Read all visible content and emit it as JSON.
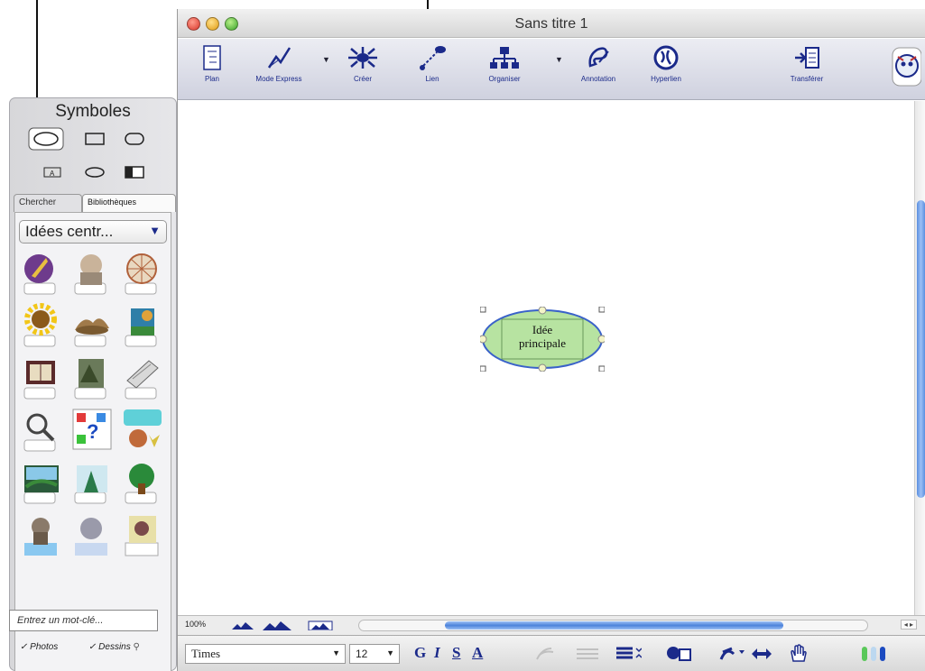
{
  "window": {
    "title": "Sans titre 1"
  },
  "toolbar": {
    "items": [
      {
        "label": "Plan",
        "icon": "outline-icon"
      },
      {
        "label": "Mode Express",
        "icon": "express-mode-icon"
      },
      {
        "label": "Créer",
        "icon": "create-icon"
      },
      {
        "label": "Lien",
        "icon": "link-icon"
      },
      {
        "label": "Organiser",
        "icon": "organize-icon"
      },
      {
        "label": "Annotation",
        "icon": "annotation-icon"
      },
      {
        "label": "Hyperlien",
        "icon": "hyperlink-icon"
      },
      {
        "label": "Transférer",
        "icon": "transfer-icon"
      }
    ]
  },
  "palette": {
    "title": "Symboles",
    "tabs": [
      "Chercher",
      "Bibliothèques"
    ],
    "library_selected": "Idées centr...",
    "search_placeholder": "Entrez un mot-clé...",
    "checkboxes": [
      {
        "label": "Photos",
        "checked": true
      },
      {
        "label": "Dessins",
        "checked": true
      }
    ]
  },
  "canvas": {
    "central_idea": {
      "line1": "Idée",
      "line2": "principale"
    },
    "node_fill": "#b7e3a1",
    "node_border": "#3a62c9"
  },
  "status": {
    "zoom": "100%"
  },
  "format": {
    "font": "Times",
    "size": "12",
    "bold": "G",
    "italic": "I",
    "underline": "S",
    "color": "A"
  },
  "colors": {
    "accent": "#1b2a8a",
    "scroll": "#5b8fe0"
  }
}
